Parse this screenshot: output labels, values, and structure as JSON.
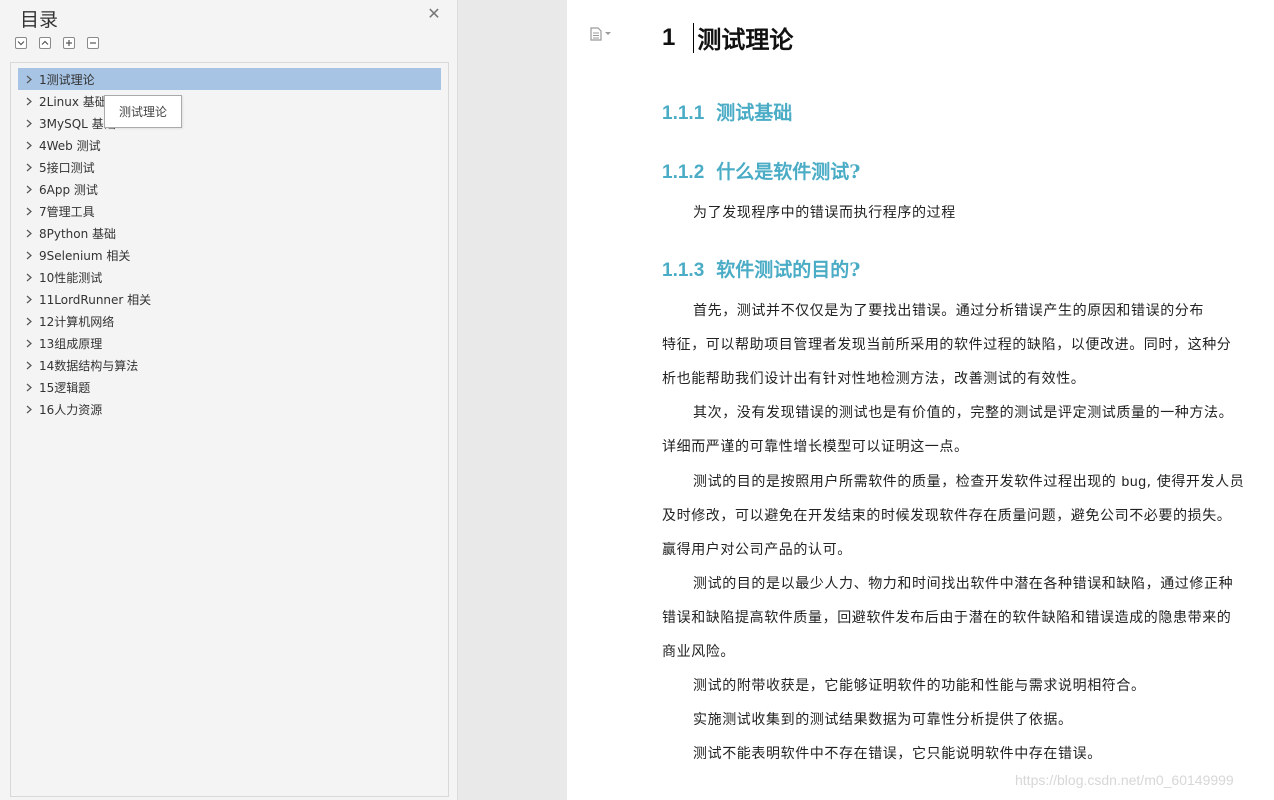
{
  "toc": {
    "title": "目录",
    "items": [
      {
        "label": "1测试理论",
        "selected": true
      },
      {
        "label": "2Linux  基础"
      },
      {
        "label": "3MySQL 基础"
      },
      {
        "label": "4Web 测试"
      },
      {
        "label": "5接口测试"
      },
      {
        "label": "6App  测试"
      },
      {
        "label": "7管理工具"
      },
      {
        "label": "8Python  基础"
      },
      {
        "label": "9Selenium  相关"
      },
      {
        "label": "10性能测试"
      },
      {
        "label": "11LordRunner 相关"
      },
      {
        "label": "12计算机网络"
      },
      {
        "label": "13组成原理"
      },
      {
        "label": "14数据结构与算法"
      },
      {
        "label": "15逻辑题"
      },
      {
        "label": "16人力资源"
      }
    ],
    "tooltip": "测试理论",
    "icons": [
      "collapse-icon",
      "expand-icon",
      "plus-icon",
      "minus-icon",
      "close-icon"
    ]
  },
  "doc": {
    "h1_num": "1",
    "h1_text": "测试理论",
    "sections": [
      {
        "num": "1.1.1",
        "title": "测试基础"
      },
      {
        "num": "1.1.2",
        "title": "什么是软件测试?"
      },
      {
        "num": "1.1.3",
        "title": "软件测试的目的?"
      }
    ],
    "p_definition": "为了发现程序中的错误而执行程序的过程",
    "p1_l1": "首先，测试并不仅仅是为了要找出错误。通过分析错误产生的原因和错误的分布",
    "p1_l2": "特征，可以帮助项目管理者发现当前所采用的软件过程的缺陷，以便改进。同时，这种分",
    "p1_l3": "析也能帮助我们设计出有针对性地检测方法，改善测试的有效性。",
    "p2_l1": "其次，没有发现错误的测试也是有价值的，完整的测试是评定测试质量的一种方法。",
    "p2_l2": "详细而严谨的可靠性增长模型可以证明这一点。",
    "p3_l1a": "测试的目的是按照用户所需软件的质量，检查开发软件过程出现的 ",
    "p3_l1b": "bug",
    "p3_l1c": ", 使得开发人员",
    "p3_l2": "及时修改，可以避免在开发结束的时候发现软件存在质量问题，避免公司不必要的损失。",
    "p3_l3": "赢得用户对公司产品的认可。",
    "p4_l1": "测试的目的是以最少人力、物力和时间找出软件中潜在各种错误和缺陷，通过修正种",
    "p4_l2": "错误和缺陷提高软件质量，回避软件发布后由于潜在的软件缺陷和错误造成的隐患带来的",
    "p4_l3": "商业风险。",
    "p5": "测试的附带收获是，它能够证明软件的功能和性能与需求说明相符合。",
    "p6": "实施测试收集到的测试结果数据为可靠性分析提供了依据。",
    "p7": "测试不能表明软件中不存在错误，它只能说明软件中存在错误。"
  },
  "watermark": "https://blog.csdn.net/m0_60149999"
}
